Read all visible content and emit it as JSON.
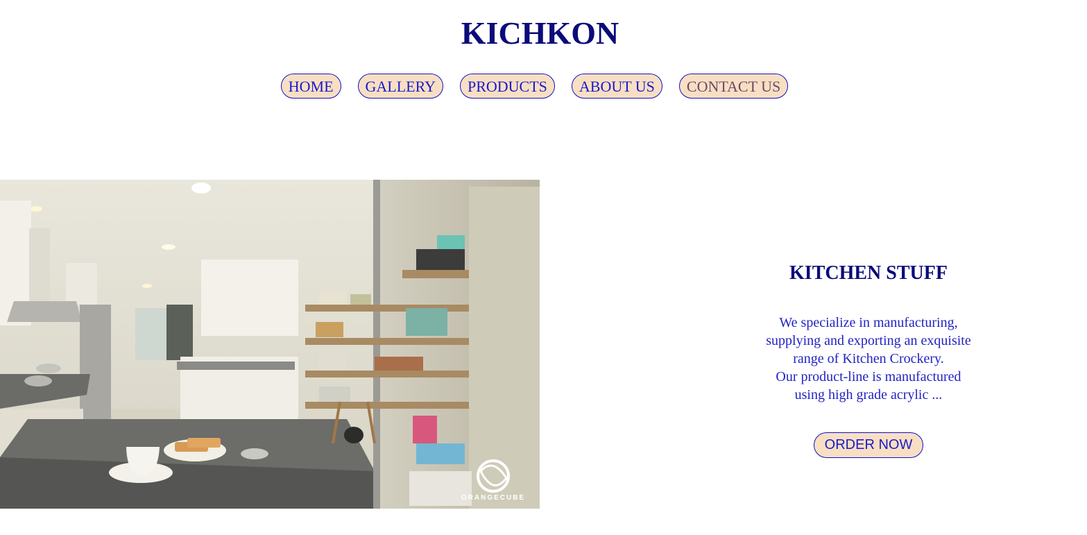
{
  "site": {
    "title": "KICHKON"
  },
  "nav": {
    "items": [
      {
        "label": "HOME"
      },
      {
        "label": "GALLERY"
      },
      {
        "label": "PRODUCTS"
      },
      {
        "label": "ABOUT US"
      },
      {
        "label": "CONTACT US"
      }
    ]
  },
  "hero": {
    "image_description": "kitchen-photo",
    "watermark": "ORANGECUBE"
  },
  "promo": {
    "title": "KITCHEN STUFF",
    "lines": [
      "We specialize in manufacturing,",
      "supplying and exporting an exquisite",
      "range of Kitchen Crockery.",
      "Our product-line is manufactured",
      "using high grade acrylic ..."
    ],
    "button_label": "ORDER NOW"
  },
  "colors": {
    "brand": "#0b0b7a",
    "link": "#1a1acc",
    "button_bg": "#f8dfc3",
    "button_border": "#1010c8"
  }
}
